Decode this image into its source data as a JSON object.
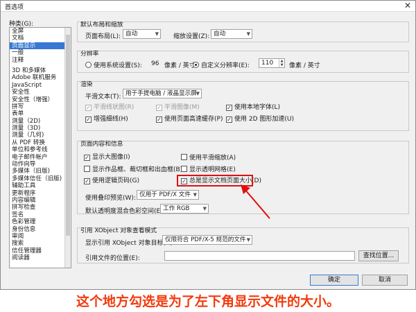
{
  "window": {
    "title": "首选项",
    "close_glyph": "✕"
  },
  "categories": {
    "label": "种类(G):",
    "items_top": [
      "全屏",
      "文档",
      "页面显示",
      "一般",
      "注释"
    ],
    "selected_index": 2,
    "items_bottom": [
      "3D 和多媒体",
      "Adobe 联机服务",
      "JavaScript",
      "安全性",
      "安全性（增强）",
      "拼写",
      "表单",
      "测量（2D)",
      "测量（3D)",
      "测量（几何)",
      "从 PDF 转换",
      "单位和参考线",
      "电子邮件帐户",
      "动作向导",
      "多媒体（旧版)",
      "多媒体信任（旧版)",
      "辅助工具",
      "更新程序",
      "内容编辑",
      "拼写检查",
      "签名",
      "色彩管理",
      "身份信息",
      "审阅",
      "搜索",
      "信任管理器",
      "阅读器"
    ]
  },
  "layout_defaults": {
    "title": "默认布局和缩放",
    "page_layout_label": "页面布局(L):",
    "page_layout_value": "自动",
    "zoom_label": "缩放设置(Z):",
    "zoom_value": "自动"
  },
  "resolution": {
    "title": "分辨率",
    "system_label": "使用系统设置(S):",
    "system_value": "96",
    "unit1": "像素 / 英寸",
    "custom_label": "自定义分辨率(E):",
    "custom_value": "110",
    "unit2": "像素 / 英寸",
    "selected": "custom"
  },
  "rendering": {
    "title": "渲染",
    "smooth_text_label": "平滑文本(T):",
    "smooth_text_value": "用于手提电脑 / 液晶显示屏",
    "smooth_lineart": "平滑线状图(R)",
    "smooth_images": "平滑图像(M)",
    "local_fonts": "使用本地字体(L)",
    "enhance_thin": "增强细线(H)",
    "page_cache": "使用页面高速缓存(P)",
    "gpu_2d": "使用 2D 图形加速(U)"
  },
  "page_content": {
    "title": "页面内容和信息",
    "show_large_images": "显示大图像(I)",
    "smooth_zoom": "使用平滑缩放(A)",
    "show_art_boxes": "显示作品框、裁切框和出血框(B)",
    "show_transparency_grid": "显示透明网格(E)",
    "logical_page_numbers": "使用逻辑页码(G)",
    "show_doc_size": "总是显示文档页面大小(D)",
    "overprint_label": "使用叠印预览(W):",
    "overprint_value": "仅用于 PDF/X 文件",
    "blend_label": "默认透明度混合色彩空间(E):",
    "blend_value": "工作 RGB"
  },
  "xobject": {
    "title": "引用 XObject 对象查看模式",
    "targets_label": "显示引用 XObject 对象目标(V):",
    "targets_value": "仅限符合 PDF/X-5 规范的文件",
    "location_label": "引用文件的位置(E):",
    "location_value": "",
    "browse_label": "查找位置..."
  },
  "buttons": {
    "ok": "确定",
    "cancel": "取消"
  },
  "caption": "这个地方勾选是为了左下角显示文件的大小。",
  "colors": {
    "highlight": "#e01010",
    "caption": "#f23a0c",
    "selection": "#3778d4"
  }
}
